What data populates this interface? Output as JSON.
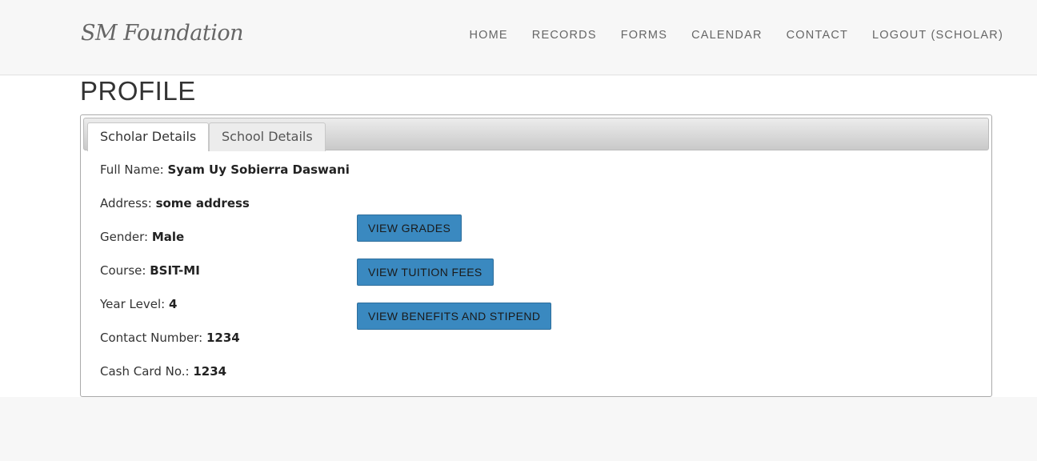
{
  "header": {
    "brand": "SM Foundation",
    "nav": [
      "HOME",
      "RECORDS",
      "FORMS",
      "CALENDAR",
      "CONTACT",
      "LOGOUT (SCHOLAR)"
    ]
  },
  "page": {
    "title": "PROFILE"
  },
  "tabs": {
    "active": "Scholar Details",
    "inactive": "School Details"
  },
  "details": [
    {
      "label": "Full Name:",
      "value": "Syam Uy Sobierra Daswani"
    },
    {
      "label": "Address:",
      "value": "some address"
    },
    {
      "label": "Gender:",
      "value": "Male"
    },
    {
      "label": "Course:",
      "value": "BSIT-MI"
    },
    {
      "label": "Year Level:",
      "value": "4"
    },
    {
      "label": "Contact Number:",
      "value": "1234"
    },
    {
      "label": "Cash Card No.:",
      "value": "1234"
    }
  ],
  "actions": {
    "view_grades": "VIEW GRADES",
    "view_tuition": "VIEW TUITION FEES",
    "view_benefits": "VIEW BENEFITS AND STIPEND"
  },
  "colors": {
    "button_bg": "#3a89c0",
    "navbar_bg": "#f7f7f7"
  }
}
